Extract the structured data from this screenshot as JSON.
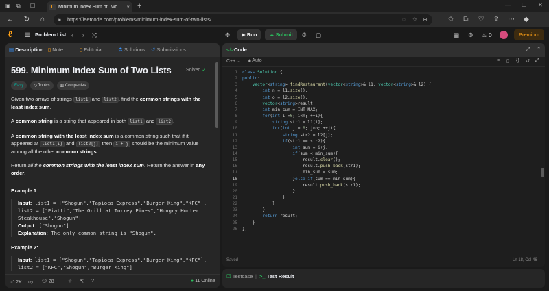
{
  "browser": {
    "tab_title": "Minimum Index Sum of Two Lists",
    "url": "https://leetcode.com/problems/minimum-index-sum-of-two-lists/"
  },
  "header": {
    "problem_list": "Problem List",
    "run": "Run",
    "submit": "Submit",
    "streak": "0",
    "premium": "Premium"
  },
  "left": {
    "tabs": [
      "Description",
      "Note",
      "Editorial",
      "Solutions",
      "Submissions"
    ],
    "title": "599. Minimum Index Sum of Two Lists",
    "solved": "Solved",
    "tags": [
      "Easy",
      "Topics",
      "Companies"
    ],
    "example1_header": "Example 1:",
    "example2_header": "Example 2:",
    "likes": "2K",
    "comments": "28",
    "online": "11 Online"
  },
  "code": {
    "tab": "Code",
    "language": "C++",
    "autocomplete": "Auto",
    "saved": "Saved",
    "cursor": "Ln 18, Col 46",
    "lines": [
      "class Solution {",
      "public:",
      "    vector<string> findRestaurant(vector<string>& l1, vector<string>& l2) {",
      "        int n = l1.size();",
      "        int o = l2.size();",
      "        vector<string>result;",
      "        int min_sum = INT_MAX;",
      "        for(int i =0; i<n; ++i){",
      "            string str1 = l1[i];",
      "            for(int j = 0; j<o; ++j){",
      "                string str2 = l2[j];",
      "                if(str1 == str2){",
      "                    int sum = i+j;",
      "                    if(sum < min_sum){",
      "                        result.clear();",
      "                        result.push_back(str1);",
      "                        min_sum = sum;",
      "                    }else if(sum == min_sum){",
      "                        result.push_back(str1);",
      "                    }",
      "                }",
      "            }",
      "        }",
      "        return result;",
      "    }",
      "};"
    ]
  },
  "bottom": {
    "testcase": "Testcase",
    "result": "Test Result"
  }
}
